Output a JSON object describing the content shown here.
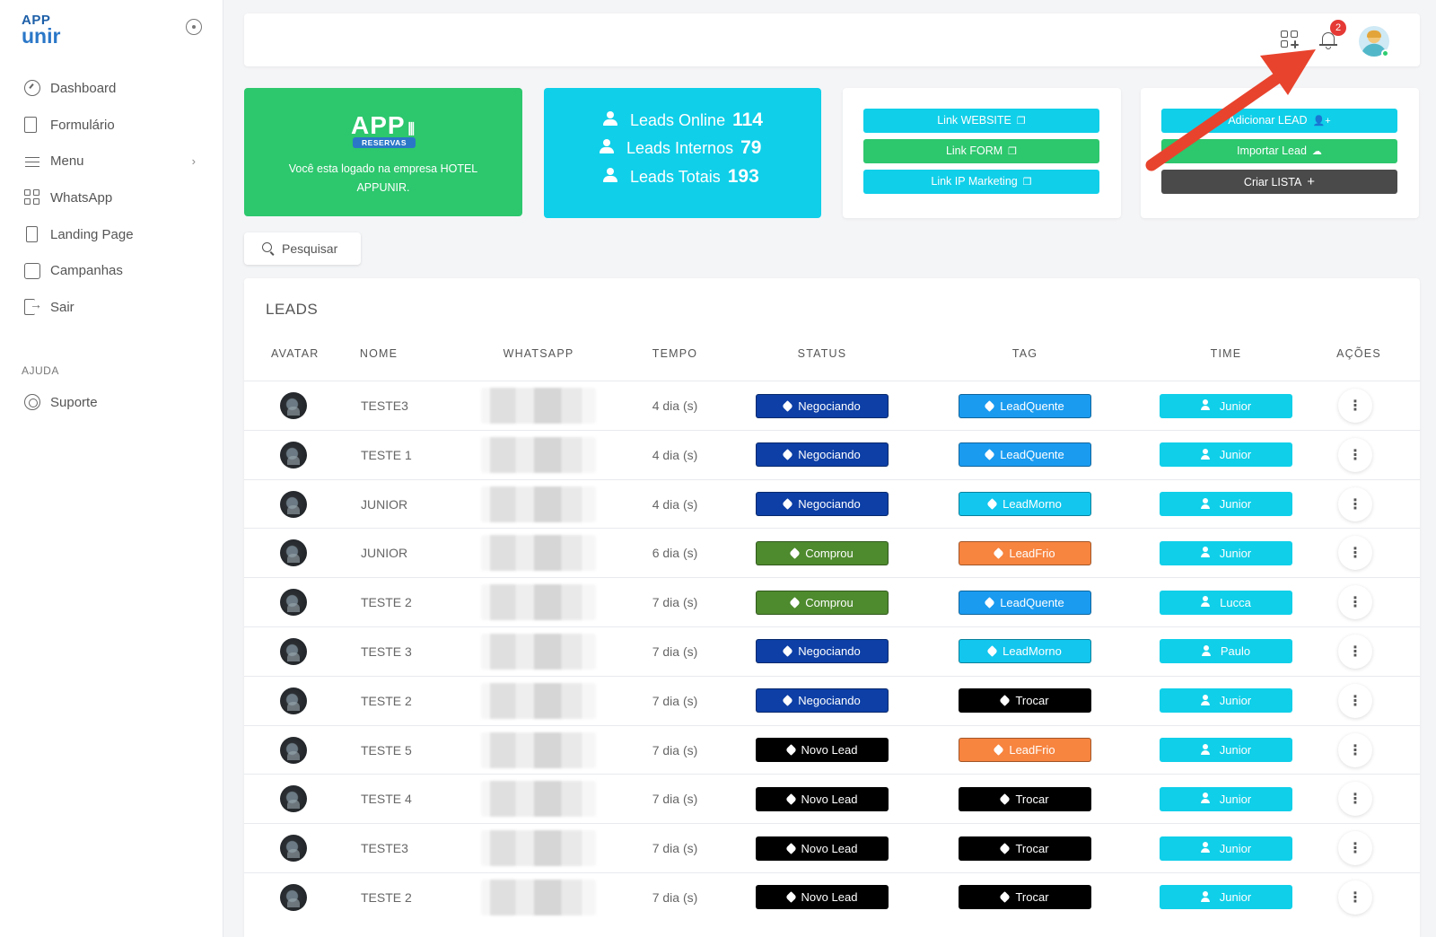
{
  "sidebar": {
    "logo": {
      "line1": "APP",
      "line2": "unir"
    },
    "items": [
      {
        "label": "Dashboard",
        "icon": "dashboard-icon"
      },
      {
        "label": "Formulário",
        "icon": "form-icon"
      },
      {
        "label": "Menu",
        "icon": "menu-icon",
        "has_submenu": true
      },
      {
        "label": "WhatsApp",
        "icon": "grid-icon"
      },
      {
        "label": "Landing Page",
        "icon": "page-icon"
      },
      {
        "label": "Campanhas",
        "icon": "chat-icon"
      },
      {
        "label": "Sair",
        "icon": "logout-icon"
      }
    ],
    "help_title": "AJUDA",
    "help_items": [
      {
        "label": "Suporte",
        "icon": "lifebuoy-icon"
      }
    ]
  },
  "topbar": {
    "notifications_count": "2"
  },
  "cards": {
    "company": {
      "brand": "APP",
      "brand_tag": "RESERVAS",
      "message": "Você esta logado na empresa HOTEL APPUNIR."
    },
    "stats": [
      {
        "label": "Leads Online",
        "value": "114"
      },
      {
        "label": "Leads Internos",
        "value": "79"
      },
      {
        "label": "Leads Totais",
        "value": "193"
      }
    ],
    "links": [
      {
        "label": "Link WEBSITE",
        "color": "#10cfe9"
      },
      {
        "label": "Link FORM",
        "color": "#2dc76d"
      },
      {
        "label": "Link IP Marketing",
        "color": "#10cfe9"
      }
    ],
    "actions": [
      {
        "label": "Adicionar LEAD",
        "color": "#10cfe9"
      },
      {
        "label": "Importar Lead",
        "color": "#2dc76d"
      },
      {
        "label": "Criar LISTA",
        "color": "#4a4a4a"
      }
    ]
  },
  "search": {
    "label": "Pesquisar"
  },
  "leads": {
    "title": "LEADS",
    "columns": [
      "AVATAR",
      "NOME",
      "WHATSAPP",
      "TEMPO",
      "STATUS",
      "TAG",
      "TIME",
      "AÇÕES"
    ],
    "rows": [
      {
        "nome": "TESTE3",
        "tempo": "4 dia (s)",
        "status": "Negociando",
        "tag": "LeadQuente",
        "time": "Junior"
      },
      {
        "nome": "TESTE 1",
        "tempo": "4 dia (s)",
        "status": "Negociando",
        "tag": "LeadQuente",
        "time": "Junior"
      },
      {
        "nome": "JUNIOR",
        "tempo": "4 dia (s)",
        "status": "Negociando",
        "tag": "LeadMorno",
        "time": "Junior"
      },
      {
        "nome": "JUNIOR",
        "tempo": "6 dia (s)",
        "status": "Comprou",
        "tag": "LeadFrio",
        "time": "Junior"
      },
      {
        "nome": "TESTE 2",
        "tempo": "7 dia (s)",
        "status": "Comprou",
        "tag": "LeadQuente",
        "time": "Lucca"
      },
      {
        "nome": "TESTE 3",
        "tempo": "7 dia (s)",
        "status": "Negociando",
        "tag": "LeadMorno",
        "time": "Paulo"
      },
      {
        "nome": "TESTE 2",
        "tempo": "7 dia (s)",
        "status": "Negociando",
        "tag": "Trocar",
        "time": "Junior"
      },
      {
        "nome": "TESTE 5",
        "tempo": "7 dia (s)",
        "status": "Novo Lead",
        "tag": "LeadFrio",
        "time": "Junior"
      },
      {
        "nome": "TESTE 4",
        "tempo": "7 dia (s)",
        "status": "Novo Lead",
        "tag": "Trocar",
        "time": "Junior"
      },
      {
        "nome": "TESTE3",
        "tempo": "7 dia (s)",
        "status": "Novo Lead",
        "tag": "Trocar",
        "time": "Junior"
      },
      {
        "nome": "TESTE 2",
        "tempo": "7 dia (s)",
        "status": "Novo Lead",
        "tag": "Trocar",
        "time": "Junior"
      }
    ]
  },
  "colors": {
    "status": {
      "Negociando": "#0d3fa6",
      "Comprou": "#4e8a2e",
      "Novo Lead": "#000000"
    },
    "tag": {
      "LeadQuente": "#1a9bf0",
      "LeadMorno": "#12c6ee",
      "LeadFrio": "#f7843f",
      "Trocar": "#000000"
    },
    "time": "#10cfe9",
    "annotation_arrow": "#e8432d"
  }
}
